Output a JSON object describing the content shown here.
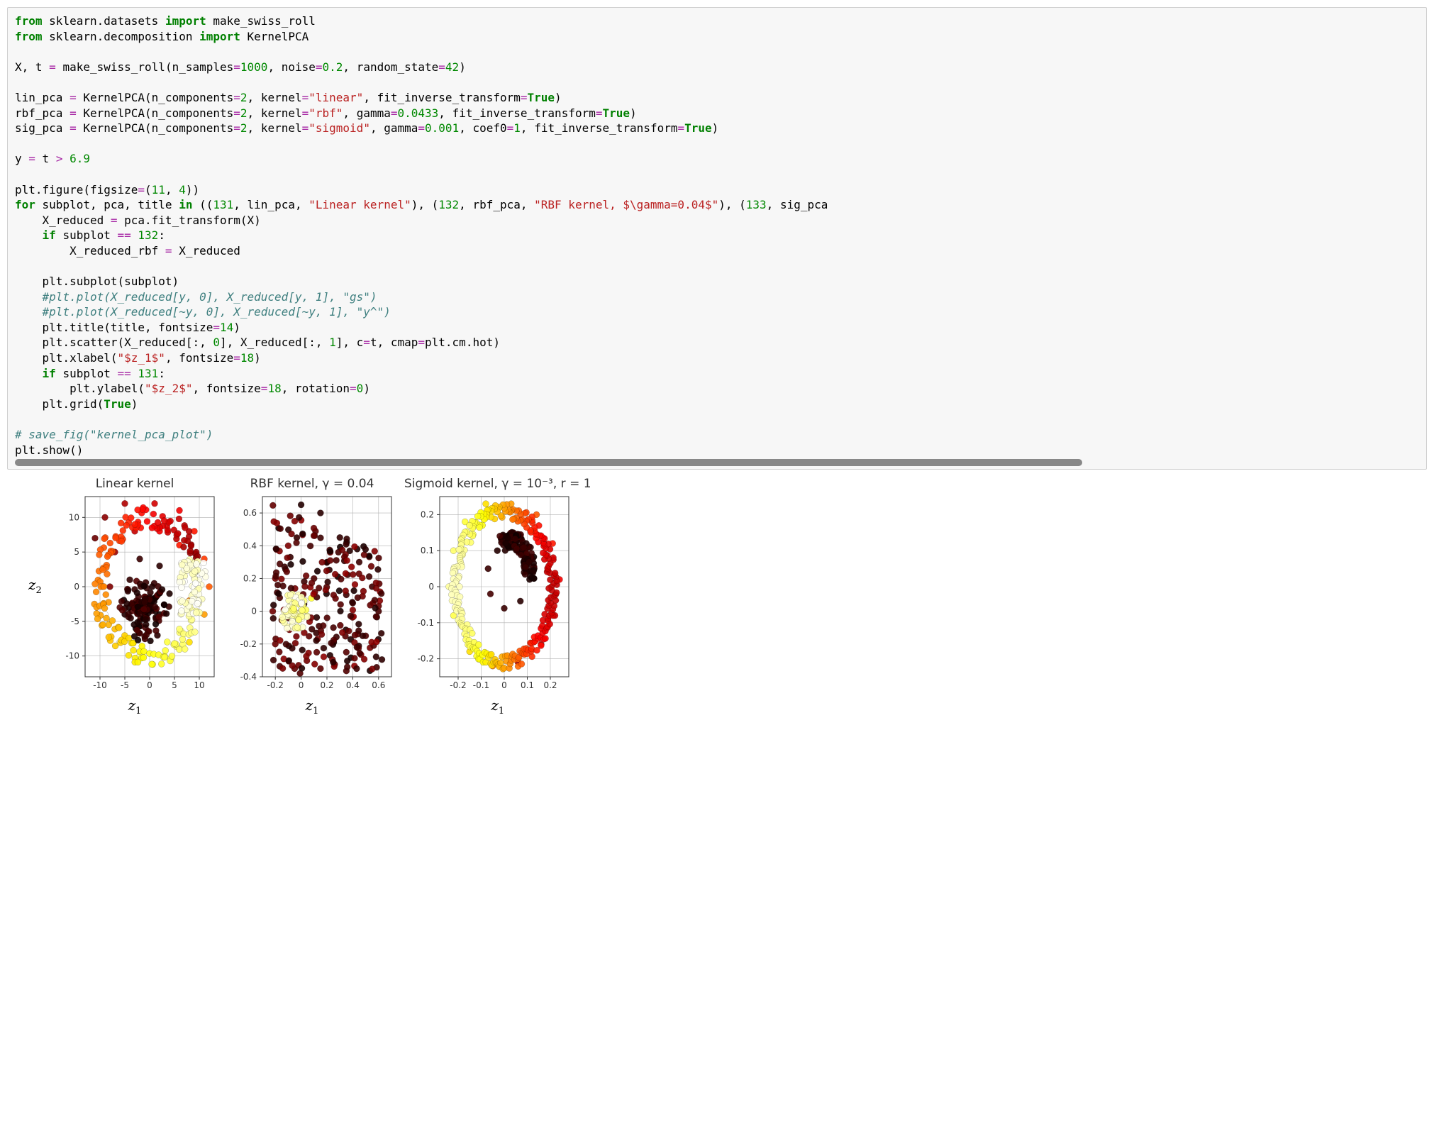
{
  "code": {
    "lines": [
      [
        {
          "t": "from ",
          "c": "kw"
        },
        {
          "t": "sklearn.datasets "
        },
        {
          "t": "import ",
          "c": "kw"
        },
        {
          "t": "make_swiss_roll"
        }
      ],
      [
        {
          "t": "from ",
          "c": "kw"
        },
        {
          "t": "sklearn.decomposition "
        },
        {
          "t": "import ",
          "c": "kw"
        },
        {
          "t": "KernelPCA"
        }
      ],
      [],
      [
        {
          "t": "X, t "
        },
        {
          "t": "=",
          "c": "op"
        },
        {
          "t": " make_swiss_roll(n_samples"
        },
        {
          "t": "=",
          "c": "op"
        },
        {
          "t": "1000",
          "c": "num"
        },
        {
          "t": ", noise"
        },
        {
          "t": "=",
          "c": "op"
        },
        {
          "t": "0.2",
          "c": "num"
        },
        {
          "t": ", random_state"
        },
        {
          "t": "=",
          "c": "op"
        },
        {
          "t": "42",
          "c": "num"
        },
        {
          "t": ")"
        }
      ],
      [],
      [
        {
          "t": "lin_pca "
        },
        {
          "t": "=",
          "c": "op"
        },
        {
          "t": " KernelPCA(n_components"
        },
        {
          "t": "=",
          "c": "op"
        },
        {
          "t": "2",
          "c": "num"
        },
        {
          "t": ", kernel"
        },
        {
          "t": "=",
          "c": "op"
        },
        {
          "t": "\"linear\"",
          "c": "str"
        },
        {
          "t": ", fit_inverse_transform"
        },
        {
          "t": "=",
          "c": "op"
        },
        {
          "t": "True",
          "c": "bool"
        },
        {
          "t": ")"
        }
      ],
      [
        {
          "t": "rbf_pca "
        },
        {
          "t": "=",
          "c": "op"
        },
        {
          "t": " KernelPCA(n_components"
        },
        {
          "t": "=",
          "c": "op"
        },
        {
          "t": "2",
          "c": "num"
        },
        {
          "t": ", kernel"
        },
        {
          "t": "=",
          "c": "op"
        },
        {
          "t": "\"rbf\"",
          "c": "str"
        },
        {
          "t": ", gamma"
        },
        {
          "t": "=",
          "c": "op"
        },
        {
          "t": "0.0433",
          "c": "num"
        },
        {
          "t": ", fit_inverse_transform"
        },
        {
          "t": "=",
          "c": "op"
        },
        {
          "t": "True",
          "c": "bool"
        },
        {
          "t": ")"
        }
      ],
      [
        {
          "t": "sig_pca "
        },
        {
          "t": "=",
          "c": "op"
        },
        {
          "t": " KernelPCA(n_components"
        },
        {
          "t": "=",
          "c": "op"
        },
        {
          "t": "2",
          "c": "num"
        },
        {
          "t": ", kernel"
        },
        {
          "t": "=",
          "c": "op"
        },
        {
          "t": "\"sigmoid\"",
          "c": "str"
        },
        {
          "t": ", gamma"
        },
        {
          "t": "=",
          "c": "op"
        },
        {
          "t": "0.001",
          "c": "num"
        },
        {
          "t": ", coef0"
        },
        {
          "t": "=",
          "c": "op"
        },
        {
          "t": "1",
          "c": "num"
        },
        {
          "t": ", fit_inverse_transform"
        },
        {
          "t": "=",
          "c": "op"
        },
        {
          "t": "True",
          "c": "bool"
        },
        {
          "t": ")"
        }
      ],
      [],
      [
        {
          "t": "y "
        },
        {
          "t": "=",
          "c": "op"
        },
        {
          "t": " t "
        },
        {
          "t": ">",
          "c": "op"
        },
        {
          "t": " "
        },
        {
          "t": "6.9",
          "c": "num"
        }
      ],
      [],
      [
        {
          "t": "plt.figure(figsize"
        },
        {
          "t": "=",
          "c": "op"
        },
        {
          "t": "("
        },
        {
          "t": "11",
          "c": "num"
        },
        {
          "t": ", "
        },
        {
          "t": "4",
          "c": "num"
        },
        {
          "t": "))"
        }
      ],
      [
        {
          "t": "for ",
          "c": "kw"
        },
        {
          "t": "subplot, pca, title "
        },
        {
          "t": "in ",
          "c": "kw"
        },
        {
          "t": "(("
        },
        {
          "t": "131",
          "c": "num"
        },
        {
          "t": ", lin_pca, "
        },
        {
          "t": "\"Linear kernel\"",
          "c": "str"
        },
        {
          "t": "), ("
        },
        {
          "t": "132",
          "c": "num"
        },
        {
          "t": ", rbf_pca, "
        },
        {
          "t": "\"RBF kernel, $\\gamma=0.04$\"",
          "c": "str"
        },
        {
          "t": "), ("
        },
        {
          "t": "133",
          "c": "num"
        },
        {
          "t": ", sig_pca"
        }
      ],
      [
        {
          "t": "    X_reduced "
        },
        {
          "t": "=",
          "c": "op"
        },
        {
          "t": " pca.fit_transform(X)"
        }
      ],
      [
        {
          "t": "    "
        },
        {
          "t": "if ",
          "c": "kw"
        },
        {
          "t": "subplot "
        },
        {
          "t": "==",
          "c": "op"
        },
        {
          "t": " "
        },
        {
          "t": "132",
          "c": "num"
        },
        {
          "t": ":"
        }
      ],
      [
        {
          "t": "        X_reduced_rbf "
        },
        {
          "t": "=",
          "c": "op"
        },
        {
          "t": " X_reduced"
        }
      ],
      [],
      [
        {
          "t": "    plt.subplot(subplot)"
        }
      ],
      [
        {
          "t": "    "
        },
        {
          "t": "#plt.plot(X_reduced[y, 0], X_reduced[y, 1], \"gs\")",
          "c": "comment"
        }
      ],
      [
        {
          "t": "    "
        },
        {
          "t": "#plt.plot(X_reduced[~y, 0], X_reduced[~y, 1], \"y^\")",
          "c": "comment"
        }
      ],
      [
        {
          "t": "    plt.title(title, fontsize"
        },
        {
          "t": "=",
          "c": "op"
        },
        {
          "t": "14",
          "c": "num"
        },
        {
          "t": ")"
        }
      ],
      [
        {
          "t": "    plt.scatter(X_reduced[:, "
        },
        {
          "t": "0",
          "c": "num"
        },
        {
          "t": "], X_reduced[:, "
        },
        {
          "t": "1",
          "c": "num"
        },
        {
          "t": "], c"
        },
        {
          "t": "=",
          "c": "op"
        },
        {
          "t": "t, cmap"
        },
        {
          "t": "=",
          "c": "op"
        },
        {
          "t": "plt.cm.hot)"
        }
      ],
      [
        {
          "t": "    plt.xlabel("
        },
        {
          "t": "\"$z_1$\"",
          "c": "str"
        },
        {
          "t": ", fontsize"
        },
        {
          "t": "=",
          "c": "op"
        },
        {
          "t": "18",
          "c": "num"
        },
        {
          "t": ")"
        }
      ],
      [
        {
          "t": "    "
        },
        {
          "t": "if ",
          "c": "kw"
        },
        {
          "t": "subplot "
        },
        {
          "t": "==",
          "c": "op"
        },
        {
          "t": " "
        },
        {
          "t": "131",
          "c": "num"
        },
        {
          "t": ":"
        }
      ],
      [
        {
          "t": "        plt.ylabel("
        },
        {
          "t": "\"$z_2$\"",
          "c": "str"
        },
        {
          "t": ", fontsize"
        },
        {
          "t": "=",
          "c": "op"
        },
        {
          "t": "18",
          "c": "num"
        },
        {
          "t": ", rotation"
        },
        {
          "t": "=",
          "c": "op"
        },
        {
          "t": "0",
          "c": "num"
        },
        {
          "t": ")"
        }
      ],
      [
        {
          "t": "    plt.grid("
        },
        {
          "t": "True",
          "c": "bool"
        },
        {
          "t": ")"
        }
      ],
      [],
      [
        {
          "t": "# save_fig(\"kernel_pca_plot\")",
          "c": "comment"
        }
      ],
      [
        {
          "t": "plt.show()"
        }
      ]
    ]
  },
  "chart_data": [
    {
      "type": "scatter",
      "title": "Linear kernel",
      "xlabel": "z₁",
      "ylabel": "z₂",
      "xlim": [
        -13,
        13
      ],
      "ylim": [
        -13,
        13
      ],
      "xticks": [
        -10,
        -5,
        0,
        5,
        10
      ],
      "yticks": [
        -10,
        -5,
        0,
        5,
        10
      ],
      "colormap": "hot",
      "note": "Swiss-roll projection; points form an overlapping spiral/ring. ~1000 points colored by t (dark→yellow).",
      "sample_points_xyc": [
        [
          -11,
          7,
          0.15
        ],
        [
          -9,
          10,
          0.2
        ],
        [
          -5,
          12,
          0.25
        ],
        [
          1,
          12,
          0.3
        ],
        [
          6,
          11,
          0.35
        ],
        [
          9,
          8,
          0.4
        ],
        [
          11,
          4,
          0.45
        ],
        [
          12,
          0,
          0.5
        ],
        [
          11,
          -4,
          0.6
        ],
        [
          8,
          -8,
          0.7
        ],
        [
          3,
          -10,
          0.8
        ],
        [
          -2,
          -10,
          0.9
        ],
        [
          -6,
          -8,
          0.95
        ],
        [
          -9,
          -4,
          1.0
        ],
        [
          -5,
          -4,
          0.05
        ],
        [
          -2,
          -5,
          0.03
        ],
        [
          2,
          -4,
          0.02
        ],
        [
          4,
          -1,
          0.04
        ],
        [
          2,
          3,
          0.06
        ],
        [
          -2,
          4,
          0.08
        ],
        [
          -4,
          1,
          0.07
        ],
        [
          8,
          -2,
          0.55
        ],
        [
          9,
          2,
          0.5
        ],
        [
          6,
          6,
          0.4
        ],
        [
          2,
          8,
          0.35
        ],
        [
          -3,
          8,
          0.28
        ],
        [
          -7,
          5,
          0.22
        ],
        [
          -8,
          0,
          0.18
        ],
        [
          -6,
          -3,
          0.12
        ]
      ]
    },
    {
      "type": "scatter",
      "title": "RBF kernel, γ = 0.04",
      "xlabel": "z₁",
      "xlim": [
        -0.3,
        0.7
      ],
      "ylim": [
        -0.4,
        0.7
      ],
      "xticks": [
        -0.2,
        0.0,
        0.2,
        0.4,
        0.6
      ],
      "yticks": [
        -0.4,
        -0.2,
        0.0,
        0.2,
        0.4,
        0.6
      ],
      "colormap": "hot",
      "note": "Triangular spread of dark-red points with a compact yellow cluster near centre-left.",
      "sample_points_xyc": [
        [
          0.0,
          0.65,
          0.05
        ],
        [
          0.15,
          0.6,
          0.06
        ],
        [
          0.3,
          0.45,
          0.07
        ],
        [
          0.45,
          0.3,
          0.08
        ],
        [
          0.55,
          0.15,
          0.09
        ],
        [
          0.6,
          0.0,
          0.1
        ],
        [
          0.5,
          -0.15,
          0.11
        ],
        [
          0.35,
          -0.25,
          0.12
        ],
        [
          0.15,
          -0.35,
          0.13
        ],
        [
          -0.05,
          -0.35,
          0.14
        ],
        [
          -0.2,
          -0.2,
          0.15
        ],
        [
          -0.22,
          0.0,
          0.16
        ],
        [
          -0.2,
          0.2,
          0.17
        ],
        [
          -0.1,
          0.4,
          0.18
        ],
        [
          -0.05,
          0.55,
          0.19
        ],
        [
          -0.1,
          0.0,
          0.85
        ],
        [
          -0.05,
          0.05,
          0.9
        ],
        [
          0.0,
          0.0,
          0.95
        ],
        [
          -0.05,
          -0.05,
          0.92
        ],
        [
          0.05,
          -0.03,
          0.88
        ],
        [
          -0.02,
          0.1,
          0.93
        ],
        [
          0.08,
          0.08,
          0.8
        ],
        [
          -0.12,
          -0.03,
          0.87
        ],
        [
          0.2,
          0.3,
          0.08
        ],
        [
          0.35,
          0.1,
          0.09
        ],
        [
          0.25,
          -0.1,
          0.1
        ],
        [
          0.1,
          0.2,
          0.11
        ],
        [
          0.4,
          0.05,
          0.1
        ]
      ]
    },
    {
      "type": "scatter",
      "title": "Sigmoid kernel, γ = 10⁻³, r = 1",
      "xlabel": "z₁",
      "xlim": [
        -0.28,
        0.28
      ],
      "ylim": [
        -0.25,
        0.25
      ],
      "xticks": [
        -0.2,
        -0.1,
        0.0,
        0.1,
        0.2
      ],
      "yticks": [
        -0.2,
        -0.1,
        0.0,
        0.1,
        0.2
      ],
      "colormap": "hot",
      "note": "Clean ring with inner crescent; outer ring yellow→orange→red, inner dark.",
      "sample_points_xyc": [
        [
          -0.24,
          0.0,
          0.9
        ],
        [
          -0.22,
          0.1,
          0.85
        ],
        [
          -0.17,
          0.18,
          0.8
        ],
        [
          -0.08,
          0.23,
          0.7
        ],
        [
          0.03,
          0.23,
          0.6
        ],
        [
          0.14,
          0.2,
          0.5
        ],
        [
          0.21,
          0.12,
          0.4
        ],
        [
          0.24,
          0.02,
          0.35
        ],
        [
          0.22,
          -0.08,
          0.3
        ],
        [
          0.16,
          -0.16,
          0.28
        ],
        [
          0.06,
          -0.21,
          0.26
        ],
        [
          -0.05,
          -0.22,
          0.55
        ],
        [
          -0.15,
          -0.18,
          0.7
        ],
        [
          -0.22,
          -0.08,
          0.82
        ],
        [
          -0.03,
          0.1,
          0.05
        ],
        [
          0.05,
          0.12,
          0.03
        ],
        [
          0.1,
          0.08,
          0.02
        ],
        [
          0.11,
          0.02,
          0.04
        ],
        [
          0.07,
          -0.04,
          0.06
        ],
        [
          0.0,
          -0.06,
          0.08
        ],
        [
          -0.06,
          -0.02,
          0.1
        ],
        [
          -0.07,
          0.05,
          0.08
        ]
      ]
    }
  ]
}
